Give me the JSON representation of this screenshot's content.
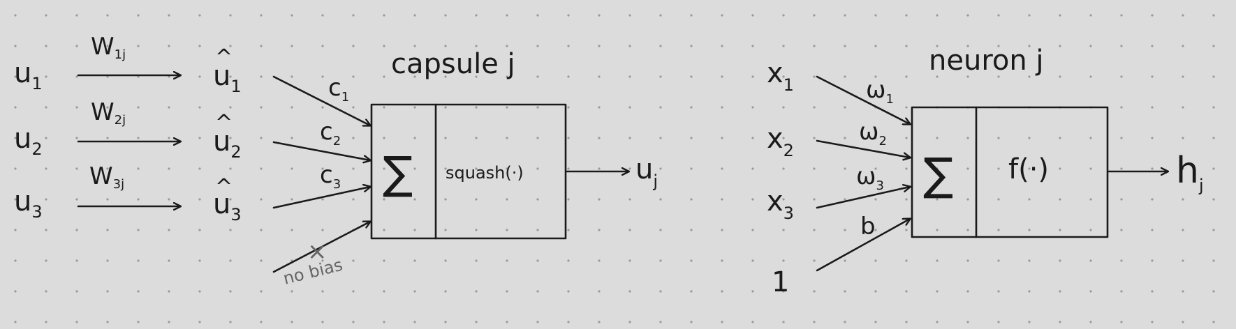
{
  "capsule": {
    "title": "capsule j",
    "inputs": [
      {
        "u": "u",
        "sub": "1",
        "weight": "W",
        "weight_sub": "1j",
        "uhat": "u",
        "uhat_sub": "1",
        "c": "c",
        "c_sub": "1"
      },
      {
        "u": "u",
        "sub": "2",
        "weight": "W",
        "weight_sub": "2j",
        "uhat": "u",
        "uhat_sub": "2",
        "c": "c",
        "c_sub": "2"
      },
      {
        "u": "u",
        "sub": "3",
        "weight": "W",
        "weight_sub": "3j",
        "uhat": "u",
        "uhat_sub": "3",
        "c": "c",
        "c_sub": "3"
      }
    ],
    "hat": "^",
    "sum_symbol": "∑",
    "function_label": "squash(·)",
    "output": "u",
    "output_sub": "j",
    "bias_note": "no bias",
    "bias_cross": "×"
  },
  "neuron": {
    "title": "neuron j",
    "inputs": [
      {
        "x": "x",
        "sub": "1",
        "w": "ω",
        "w_sub": "1"
      },
      {
        "x": "x",
        "sub": "2",
        "w": "ω",
        "w_sub": "2"
      },
      {
        "x": "x",
        "sub": "3",
        "w": "ω",
        "w_sub": "3"
      }
    ],
    "bias_input": "1",
    "bias_weight": "b",
    "sum_symbol": "∑",
    "function_label": "f(·)",
    "output": "h",
    "output_sub": "j"
  }
}
